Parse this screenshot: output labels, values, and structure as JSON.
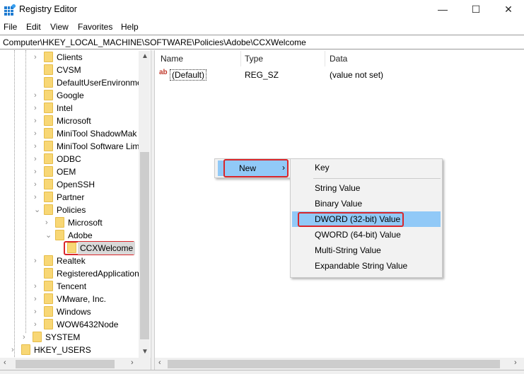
{
  "window": {
    "title": "Registry Editor",
    "minimize": "—",
    "maximize": "☐",
    "close": "✕"
  },
  "menubar": [
    "File",
    "Edit",
    "View",
    "Favorites",
    "Help"
  ],
  "address": "Computer\\HKEY_LOCAL_MACHINE\\SOFTWARE\\Policies\\Adobe\\CCXWelcome",
  "tree": [
    {
      "label": "Clients",
      "level": 2,
      "chevron": "right"
    },
    {
      "label": "CVSM",
      "level": 2,
      "chevron": ""
    },
    {
      "label": "DefaultUserEnvironme",
      "level": 2,
      "chevron": ""
    },
    {
      "label": "Google",
      "level": 2,
      "chevron": "right"
    },
    {
      "label": "Intel",
      "level": 2,
      "chevron": "right"
    },
    {
      "label": "Microsoft",
      "level": 2,
      "chevron": "right"
    },
    {
      "label": "MiniTool ShadowMak",
      "level": 2,
      "chevron": "right"
    },
    {
      "label": "MiniTool Software Lim",
      "level": 2,
      "chevron": "right"
    },
    {
      "label": "ODBC",
      "level": 2,
      "chevron": "right"
    },
    {
      "label": "OEM",
      "level": 2,
      "chevron": "right"
    },
    {
      "label": "OpenSSH",
      "level": 2,
      "chevron": "right"
    },
    {
      "label": "Partner",
      "level": 2,
      "chevron": "right"
    },
    {
      "label": "Policies",
      "level": 2,
      "chevron": "down"
    },
    {
      "label": "Microsoft",
      "level": 3,
      "chevron": "right"
    },
    {
      "label": "Adobe",
      "level": 3,
      "chevron": "down"
    },
    {
      "label": "CCXWelcome",
      "level": 4,
      "chevron": "",
      "selected": true
    },
    {
      "label": "Realtek",
      "level": 2,
      "chevron": "right"
    },
    {
      "label": "RegisteredApplication",
      "level": 2,
      "chevron": ""
    },
    {
      "label": "Tencent",
      "level": 2,
      "chevron": "right"
    },
    {
      "label": "VMware, Inc.",
      "level": 2,
      "chevron": "right"
    },
    {
      "label": "Windows",
      "level": 2,
      "chevron": "right"
    },
    {
      "label": "WOW6432Node",
      "level": 2,
      "chevron": "right"
    },
    {
      "label": "SYSTEM",
      "level": 1,
      "chevron": "right"
    },
    {
      "label": "HKEY_USERS",
      "level": 0,
      "chevron": "right"
    }
  ],
  "columns": {
    "name": "Name",
    "type": "Type",
    "data": "Data"
  },
  "values": [
    {
      "icon": "ab",
      "name": "(Default)",
      "type": "REG_SZ",
      "data": "(value not set)"
    }
  ],
  "context_menu": {
    "new": "New",
    "arrow": "›"
  },
  "submenu": [
    "Key",
    "String Value",
    "Binary Value",
    "DWORD (32-bit) Value",
    "QWORD (64-bit) Value",
    "Multi-String Value",
    "Expandable String Value"
  ],
  "highlight_color": "#d9262b",
  "hover_color": "#91c9f7"
}
